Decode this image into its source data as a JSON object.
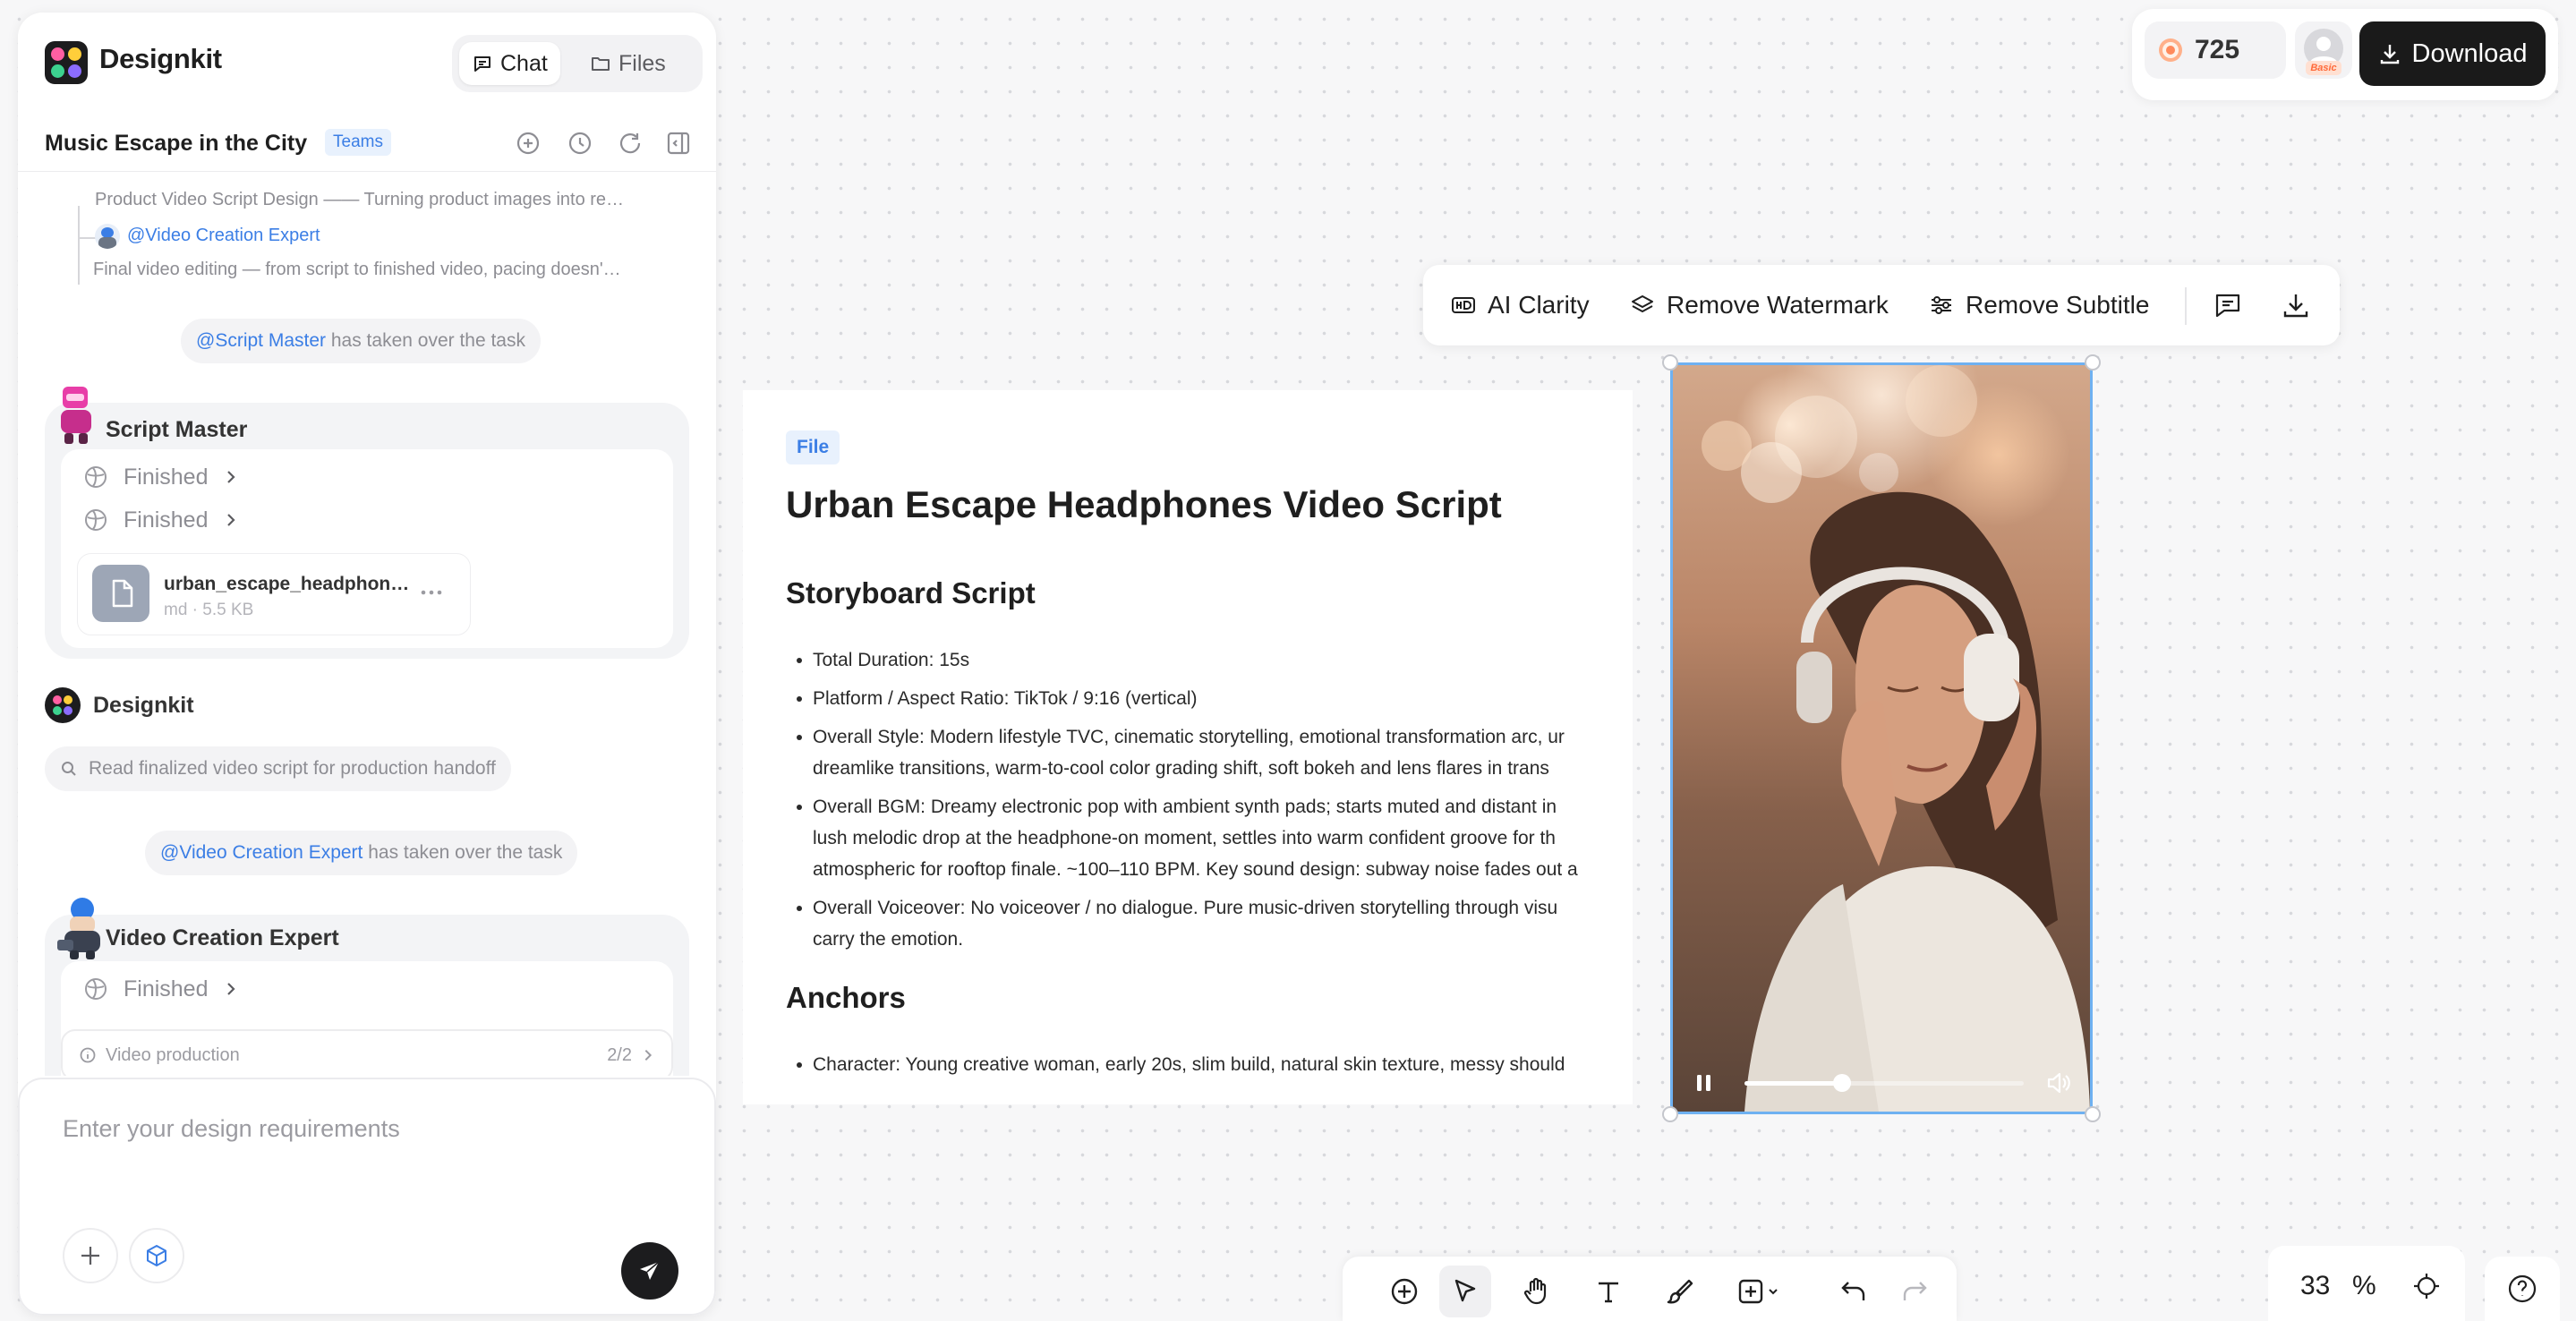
{
  "app": {
    "name": "Designkit"
  },
  "tabs": [
    {
      "label": "Chat",
      "active": true
    },
    {
      "label": "Files",
      "active": false
    }
  ],
  "project": {
    "title": "Music Escape in the City",
    "badge": "Teams"
  },
  "chat": {
    "refs": {
      "line1": "Product Video Script Design —— Turning product images into re…",
      "mention": "@Video Creation Expert",
      "line2": "Final video editing — from script to finished video, pacing doesn'…"
    },
    "takeover1": {
      "mention": "@Script Master",
      "text": "has taken over the task"
    },
    "script_master": {
      "name": "Script Master",
      "steps": [
        "Finished",
        "Finished"
      ],
      "file": {
        "name": "urban_escape_headphon…",
        "meta": "md · 5.5 KB"
      }
    },
    "designkit": {
      "name": "Designkit",
      "action": "Read finalized video script for production handoff"
    },
    "takeover2": {
      "mention": "@Video Creation Expert",
      "text": "has taken over the task"
    },
    "video_expert": {
      "name": "Video Creation Expert",
      "step": "Finished",
      "task": {
        "label": "Video production",
        "progress": "2/2"
      }
    }
  },
  "input": {
    "placeholder": "Enter your design requirements"
  },
  "topright": {
    "credits": "725",
    "plan": "Basic",
    "download": "Download"
  },
  "document": {
    "tag": "File",
    "title": "Urban Escape Headphones Video Script",
    "section1": "Storyboard Script",
    "bullets": [
      "Total Duration: 15s",
      "Platform / Aspect Ratio: TikTok / 9:16 (vertical)",
      "Overall Style: Modern lifestyle TVC, cinematic storytelling, emotional transformation arc, ur dreamlike transitions, warm-to-cool color grading shift, soft bokeh and lens flares in trans",
      "Overall BGM: Dreamy electronic pop with ambient synth pads; starts muted and distant in lush melodic drop at the headphone-on moment, settles into warm confident groove for th atmospheric for rooftop finale. ~100–110 BPM. Key sound design: subway noise fades out a",
      "Overall Voiceover: No voiceover / no dialogue. Pure music-driven storytelling through visu carry the emotion."
    ],
    "section2": "Anchors",
    "anchor_bullet": "Character: Young creative woman, early 20s, slim build, natural skin texture, messy should"
  },
  "image_toolbar": {
    "ai_clarity": "AI Clarity",
    "remove_watermark": "Remove Watermark",
    "remove_subtitle": "Remove Subtitle"
  },
  "video": {
    "progress": 0.35
  },
  "zoom": {
    "value": "33",
    "unit": "%"
  },
  "colors": {
    "accent": "#3b7ee5",
    "dark": "#1a1a1a",
    "selection": "#6fb1f1"
  }
}
